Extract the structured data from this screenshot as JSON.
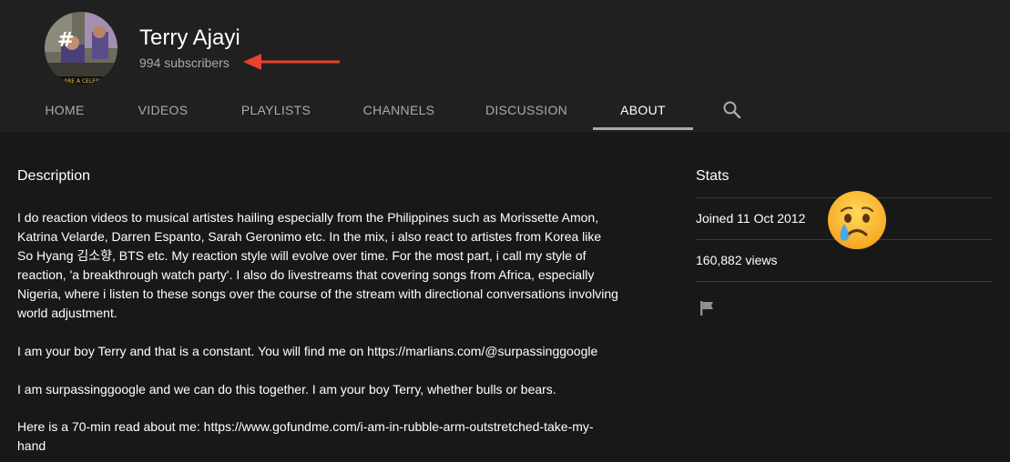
{
  "channel": {
    "name": "Terry Ajayi",
    "subscribers": "994 subscribers",
    "avatar_caption": "ARE A CELEB"
  },
  "tabs": [
    {
      "label": "HOME"
    },
    {
      "label": "VIDEOS"
    },
    {
      "label": "PLAYLISTS"
    },
    {
      "label": "CHANNELS"
    },
    {
      "label": "DISCUSSION"
    },
    {
      "label": "ABOUT"
    }
  ],
  "active_tab": "ABOUT",
  "about": {
    "description_title": "Description",
    "paragraphs": [
      "I do reaction videos to musical artistes hailing especially from the Philippines such as Morissette Amon, Katrina Velarde, Darren Espanto, Sarah Geronimo etc. In the mix, i also react to artistes from Korea like So Hyang 김소향, BTS etc. My reaction style will evolve over time. For the most part, i call my style of reaction, 'a breakthrough watch party'. I also do livestreams that covering songs from Africa, especially Nigeria, where i listen to these songs over the course of the stream with directional conversations involving world adjustment.",
      "I am your boy Terry and that is a constant. You will find me on https://marlians.com/@surpassinggoogle",
      "I am surpassinggoogle and we can do this together. I am your boy Terry, whether bulls or bears.",
      "Here is a 70-min read about me: https://www.gofundme.com/i-am-in-rubble-arm-outstretched-take-my-hand"
    ]
  },
  "stats": {
    "title": "Stats",
    "joined": "Joined 11 Oct 2012",
    "views": "160,882 views"
  },
  "colors": {
    "header_bg": "#202020",
    "page_bg": "#181818",
    "muted_text": "#aaaaaa",
    "annotation_arrow": "#e8412c"
  },
  "icons": {
    "search": "search-icon",
    "flag": "flag-icon",
    "annotation": "crying-face-emoji"
  }
}
